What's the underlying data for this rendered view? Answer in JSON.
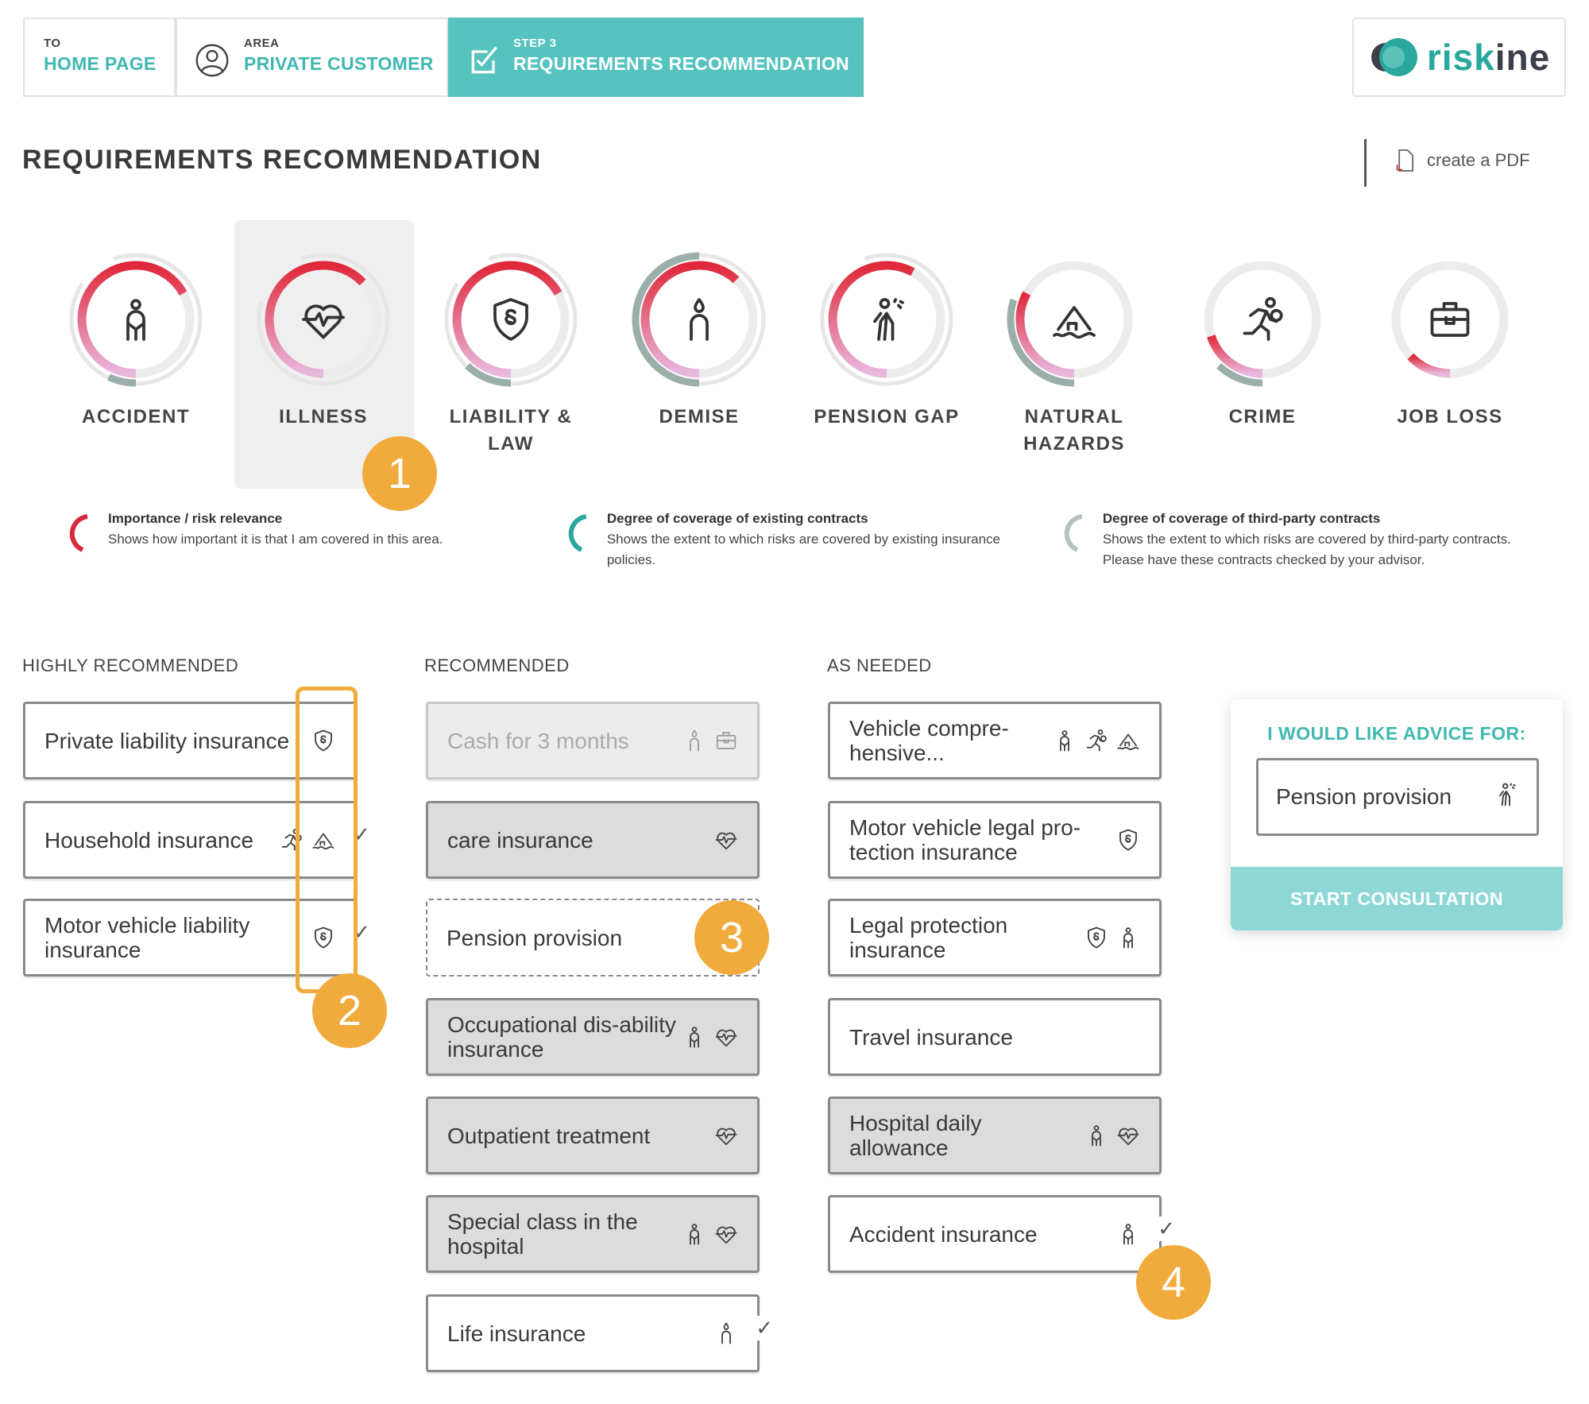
{
  "nav": {
    "home": {
      "small": "TO",
      "big": "HOME PAGE"
    },
    "area": {
      "small": "AREA",
      "big": "PRIVATE CUSTOMER"
    },
    "step": {
      "small": "STEP 3",
      "big": "REQUIREMENTS RECOMMENDATION"
    }
  },
  "logo": {
    "part1": "risk",
    "part2": "ine"
  },
  "page_title": "REQUIREMENTS RECOMMENDATION",
  "pdf_label": "create a PDF",
  "colors": {
    "accent": "#56c3bf",
    "importance_top": "#e0283a",
    "importance_bottom": "#e9b8de",
    "existing": "#9aaeaa",
    "third_party": "#e6e6e6",
    "badge": "#f0ab3c"
  },
  "risks": [
    {
      "label": "ACCIDENT",
      "icon": "accident",
      "importance": 0.67,
      "existing": 0.07,
      "third_party": 0.9
    },
    {
      "label": "ILLNESS",
      "icon": "illness",
      "importance": 0.63,
      "existing": 0,
      "third_party": 0.85,
      "selected": true
    },
    {
      "label": "LIABILITY & LAW",
      "icon": "law",
      "importance": 0.67,
      "existing": 0.12,
      "third_party": 0.9
    },
    {
      "label": "DEMISE",
      "icon": "demise",
      "importance": 0.62,
      "existing": 0.5,
      "third_party": 0.9
    },
    {
      "label": "PENSION GAP",
      "icon": "pension",
      "importance": 0.58,
      "existing": 0,
      "third_party": 0.9
    },
    {
      "label": "NATURAL HAZARDS",
      "icon": "natural",
      "importance": 0.33,
      "existing": 0.3,
      "third_party": 0
    },
    {
      "label": "CRIME",
      "icon": "crime",
      "importance": 0.2,
      "existing": 0.12,
      "third_party": 0
    },
    {
      "label": "JOB LOSS",
      "icon": "jobloss",
      "importance": 0.13,
      "existing": 0,
      "third_party": 0
    }
  ],
  "legend": [
    {
      "title": "Importance / risk relevance",
      "text": "Shows how important it is that I am covered in this area."
    },
    {
      "title": "Degree of coverage of existing contracts",
      "text": "Shows the extent to which risks are covered by existing insurance policies."
    },
    {
      "title": "Degree of coverage of third-party contracts",
      "text": "Shows the extent to which risks are covered by third-party contracts. Please have these contracts checked by your advisor."
    }
  ],
  "columns": [
    {
      "title": "HIGHLY RECOMMENDED",
      "cards": [
        {
          "label": "Private liability insurance",
          "style": "white",
          "icons": [
            "law"
          ],
          "checked": false
        },
        {
          "label": "Household insurance",
          "style": "white",
          "icons": [
            "crime",
            "natural"
          ],
          "checked": true
        },
        {
          "label": "Motor vehicle liability insurance",
          "style": "white",
          "icons": [
            "law"
          ],
          "checked": true
        }
      ]
    },
    {
      "title": "RECOMMENDED",
      "cards": [
        {
          "label": "Cash for 3 months",
          "style": "disabled",
          "icons": [
            "demise",
            "jobloss"
          ],
          "checked": false
        },
        {
          "label": "care insurance",
          "style": "grey",
          "icons": [
            "illness"
          ],
          "checked": false
        },
        {
          "label": "Pension provision",
          "style": "dashed",
          "icons": [],
          "checked": false
        },
        {
          "label": "Occupational dis-ability insurance",
          "style": "grey",
          "icons": [
            "accident",
            "illness"
          ],
          "checked": false
        },
        {
          "label": "Outpatient treatment",
          "style": "grey",
          "icons": [
            "illness"
          ],
          "checked": false
        },
        {
          "label": "Special class in the hospital",
          "style": "grey",
          "icons": [
            "accident",
            "illness"
          ],
          "checked": false
        },
        {
          "label": "Life insurance",
          "style": "white",
          "icons": [
            "demise"
          ],
          "checked": true
        }
      ]
    },
    {
      "title": "AS NEEDED",
      "cards": [
        {
          "label": "Vehicle compre-hensive...",
          "style": "white",
          "icons": [
            "accident",
            "crime",
            "natural"
          ],
          "checked": false
        },
        {
          "label": "Motor vehicle legal pro-tection insurance",
          "style": "white",
          "icons": [
            "law"
          ],
          "checked": false
        },
        {
          "label": "Legal protection insurance",
          "style": "white",
          "icons": [
            "law",
            "accident"
          ],
          "checked": false
        },
        {
          "label": "Travel insurance",
          "style": "white",
          "icons": [],
          "checked": false
        },
        {
          "label": "Hospital daily allowance",
          "style": "grey",
          "icons": [
            "accident",
            "illness"
          ],
          "checked": false
        },
        {
          "label": "Accident insurance",
          "style": "white",
          "icons": [
            "accident"
          ],
          "checked": true
        }
      ]
    }
  ],
  "advice": {
    "title": "I WOULD LIKE ADVICE FOR:",
    "selected": "Pension provision",
    "selected_icon": "pension",
    "button": "START CONSULTATION"
  },
  "badges": [
    "1",
    "2",
    "3",
    "4"
  ],
  "check_mark": "✓"
}
